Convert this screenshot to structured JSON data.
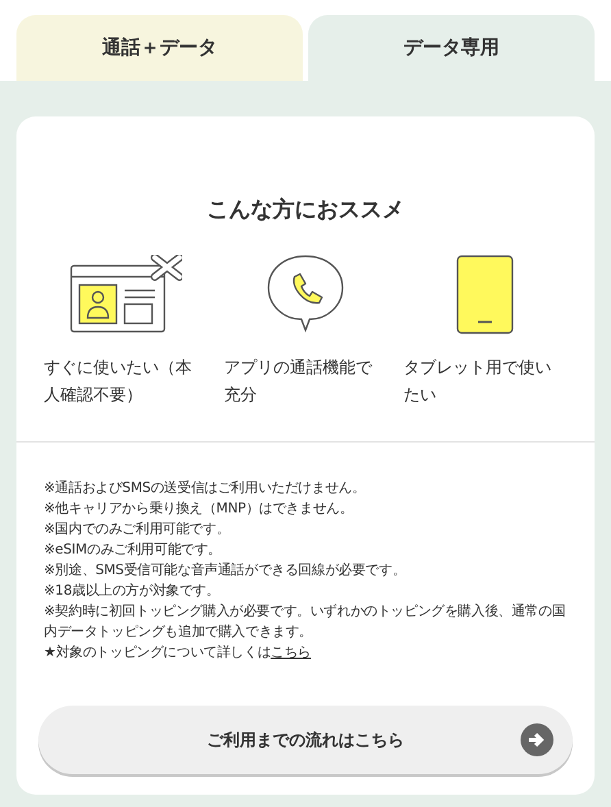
{
  "tabs": [
    {
      "label": "通話＋データ",
      "selected": false
    },
    {
      "label": "データ専用",
      "selected": true
    }
  ],
  "card": {
    "heading": "こんな方におススメ",
    "features": [
      {
        "kind": "id-card",
        "label": "すぐに使いたい（本人確認不要）"
      },
      {
        "kind": "call",
        "label": "アプリの通話機能で充分"
      },
      {
        "kind": "tablet",
        "label": "タブレット用で使いたい"
      }
    ],
    "notes": [
      "※通話およびSMSの送受信はご利用いただけません。",
      "※他キャリアから乗り換え（MNP）はできません。",
      "※国内でのみご利用可能です。",
      "※eSIMのみご利用可能です。",
      "※別途、SMS受信可能な音声通話ができる回線が必要です。",
      "※18歳以上の方が対象です。",
      "※契約時に初回トッピング購入が必要です。いずれかのトッピングを購入後、通常の国内データトッピングも追加で購入できます。"
    ],
    "detail": {
      "text": "★対象のトッピングについて詳しくは",
      "link": "こちら"
    },
    "button": "ご利用までの流れはこちら"
  }
}
